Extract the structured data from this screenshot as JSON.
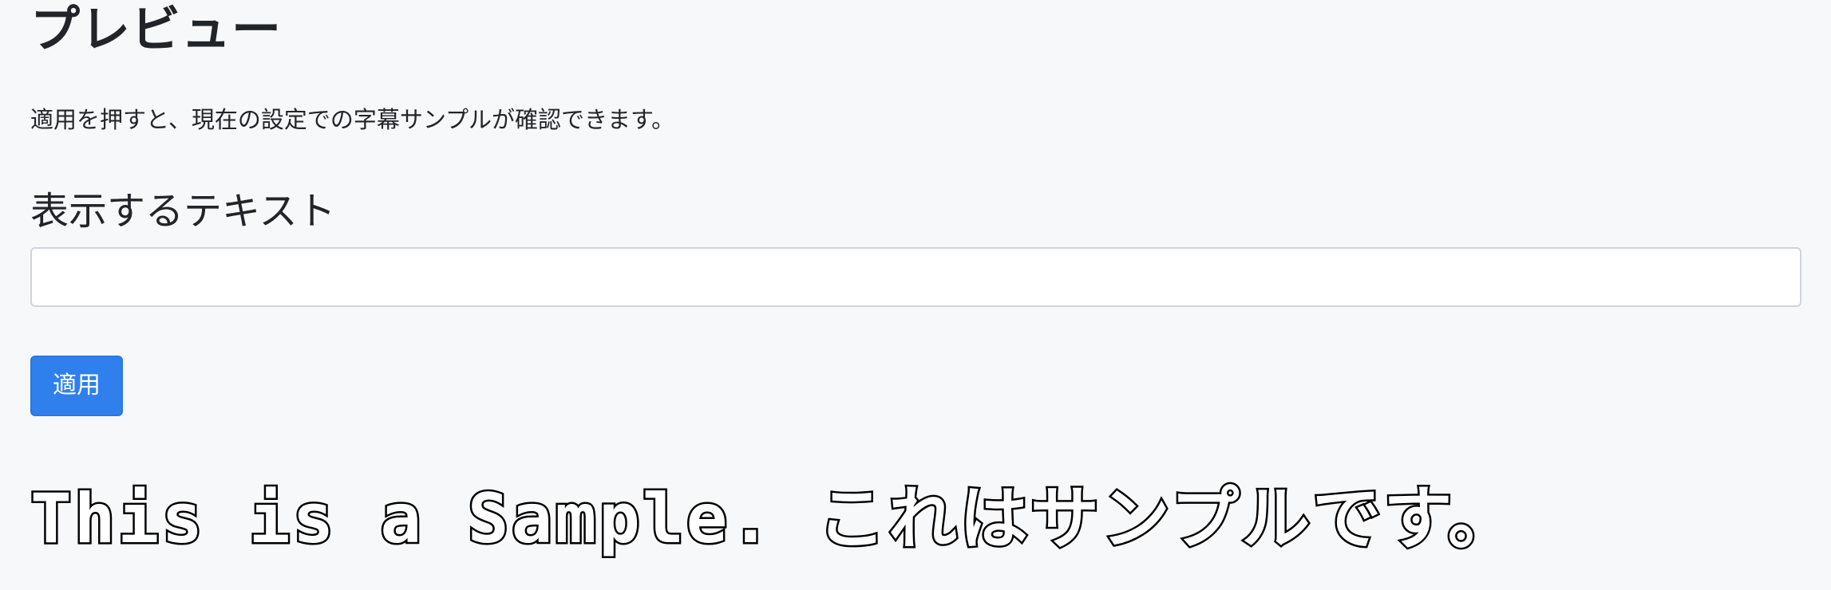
{
  "page": {
    "title": "プレビュー",
    "description": "適用を押すと、現在の設定での字幕サンプルが確認できます。"
  },
  "form": {
    "text_label": "表示するテキスト",
    "text_value": "",
    "text_placeholder": "",
    "apply_label": "適用"
  },
  "preview": {
    "sample_text": "This is a Sample. これはサンプルです。",
    "fill_color": "#ffffff",
    "stroke_color": "#000000"
  },
  "colors": {
    "background": "#f7f8fa",
    "accent": "#2f80ed",
    "text": "#212529"
  }
}
